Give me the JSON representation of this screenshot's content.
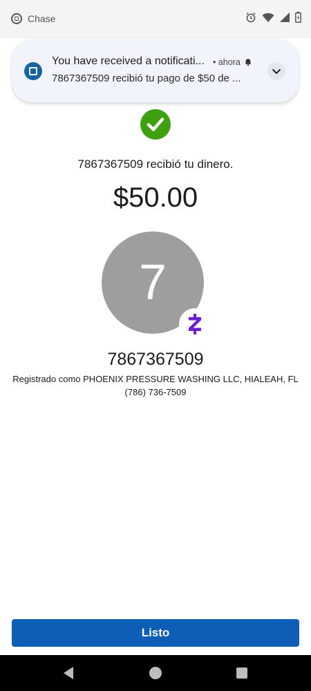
{
  "statusbar": {
    "app_name": "Chase",
    "icons": [
      "chase-logo-icon",
      "alarm-icon",
      "wifi-icon",
      "signal-icon",
      "battery-icon"
    ]
  },
  "notification": {
    "title": "You have received a notificati...",
    "time": "• ahora",
    "body": "7867367509 recibió tu pago de $50 de ...",
    "icons": [
      "chase-logo-icon",
      "bell-icon",
      "chevron-down-icon"
    ]
  },
  "confirmation": {
    "message": "7867367509 recibió tu dinero.",
    "amount": "$50.00",
    "status_color": "#3ea00e"
  },
  "recipient": {
    "avatar_initial": "7",
    "name": "7867367509",
    "registered_as": "Registrado como PHOENIX PRESSURE WASHING LLC, HIALEAH, FL",
    "phone": "(786) 736-7509",
    "badge_color": "#6d1ed4"
  },
  "actions": {
    "done_label": "Listo",
    "done_color": "#0e5db6"
  },
  "navbar": {
    "icons": [
      "back-icon",
      "home-icon",
      "recents-icon"
    ]
  }
}
